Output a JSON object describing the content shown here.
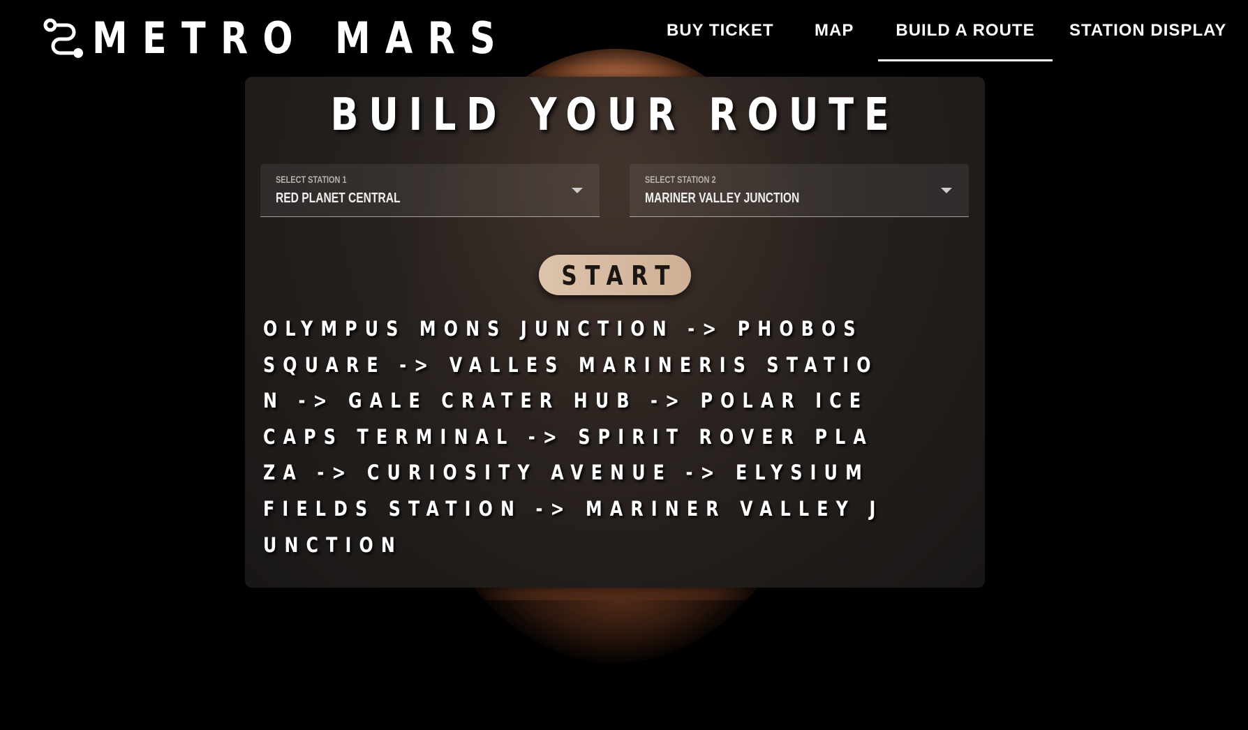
{
  "app": {
    "title": "METRO MARS"
  },
  "nav": {
    "items": [
      {
        "label": "BUY TICKET"
      },
      {
        "label": "MAP"
      },
      {
        "label": "BUILD A ROUTE",
        "active": true
      },
      {
        "label": "STATION DISPLAY"
      }
    ]
  },
  "main": {
    "title": "BUILD YOUR ROUTE",
    "station1": {
      "label": "SELECT STATION 1",
      "value": "RED PLANET CENTRAL"
    },
    "station2": {
      "label": "SELECT STATION 2",
      "value": "MARINER VALLEY JUNCTION"
    },
    "start_label": "START",
    "route": "OLYMPUS MONS JUNCTION -> PHOBOS SQUARE -> VALLES MARINERIS STATION -> GALE CRATER HUB -> POLAR ICE CAPS TERMINAL -> SPIRIT ROVER PLAZA -> CURIOSITY AVENUE -> ELYSIUM FIELDS STATION -> MARINER VALLEY JUNCTION"
  },
  "colors": {
    "background": "#000000",
    "card": "#2a2421",
    "button": "#d8bca3",
    "planet": "#a85d36"
  }
}
